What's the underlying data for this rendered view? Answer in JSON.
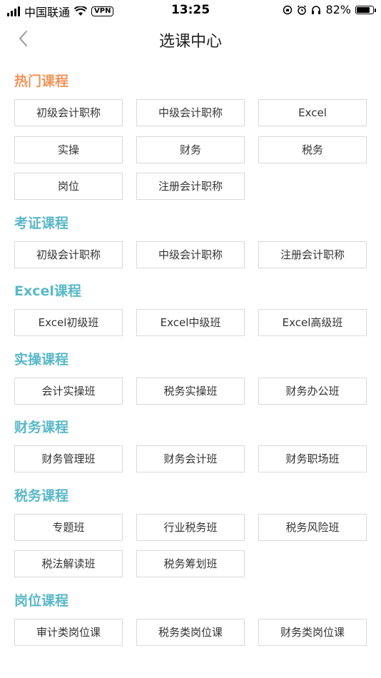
{
  "status_bar": {
    "carrier": "中国联通",
    "vpn": "VPN",
    "time": "13:25",
    "battery": "82%",
    "battery_level": 0.82
  },
  "nav": {
    "title": "选课中心"
  },
  "colors": {
    "hot_title": "#f0955a",
    "section_title": "#5ab8c8",
    "button_border": "#d9d9d9"
  },
  "sections": [
    {
      "title": "热门课程",
      "items": [
        "初级会计职称",
        "中级会计职称",
        "Excel",
        "实操",
        "财务",
        "税务",
        "岗位",
        "注册会计职称"
      ]
    },
    {
      "title": "考证课程",
      "items": [
        "初级会计职称",
        "中级会计职称",
        "注册会计职称"
      ]
    },
    {
      "title": "Excel课程",
      "items": [
        "Excel初级班",
        "Excel中级班",
        "Excel高级班"
      ]
    },
    {
      "title": "实操课程",
      "items": [
        "会计实操班",
        "税务实操班",
        "财务办公班"
      ]
    },
    {
      "title": "财务课程",
      "items": [
        "财务管理班",
        "财务会计班",
        "财务职场班"
      ]
    },
    {
      "title": "税务课程",
      "items": [
        "专题班",
        "行业税务班",
        "税务风险班",
        "税法解读班",
        "税务筹划班"
      ]
    },
    {
      "title": "岗位课程",
      "items": [
        "审计类岗位课",
        "税务类岗位课",
        "财务类岗位课"
      ]
    }
  ]
}
